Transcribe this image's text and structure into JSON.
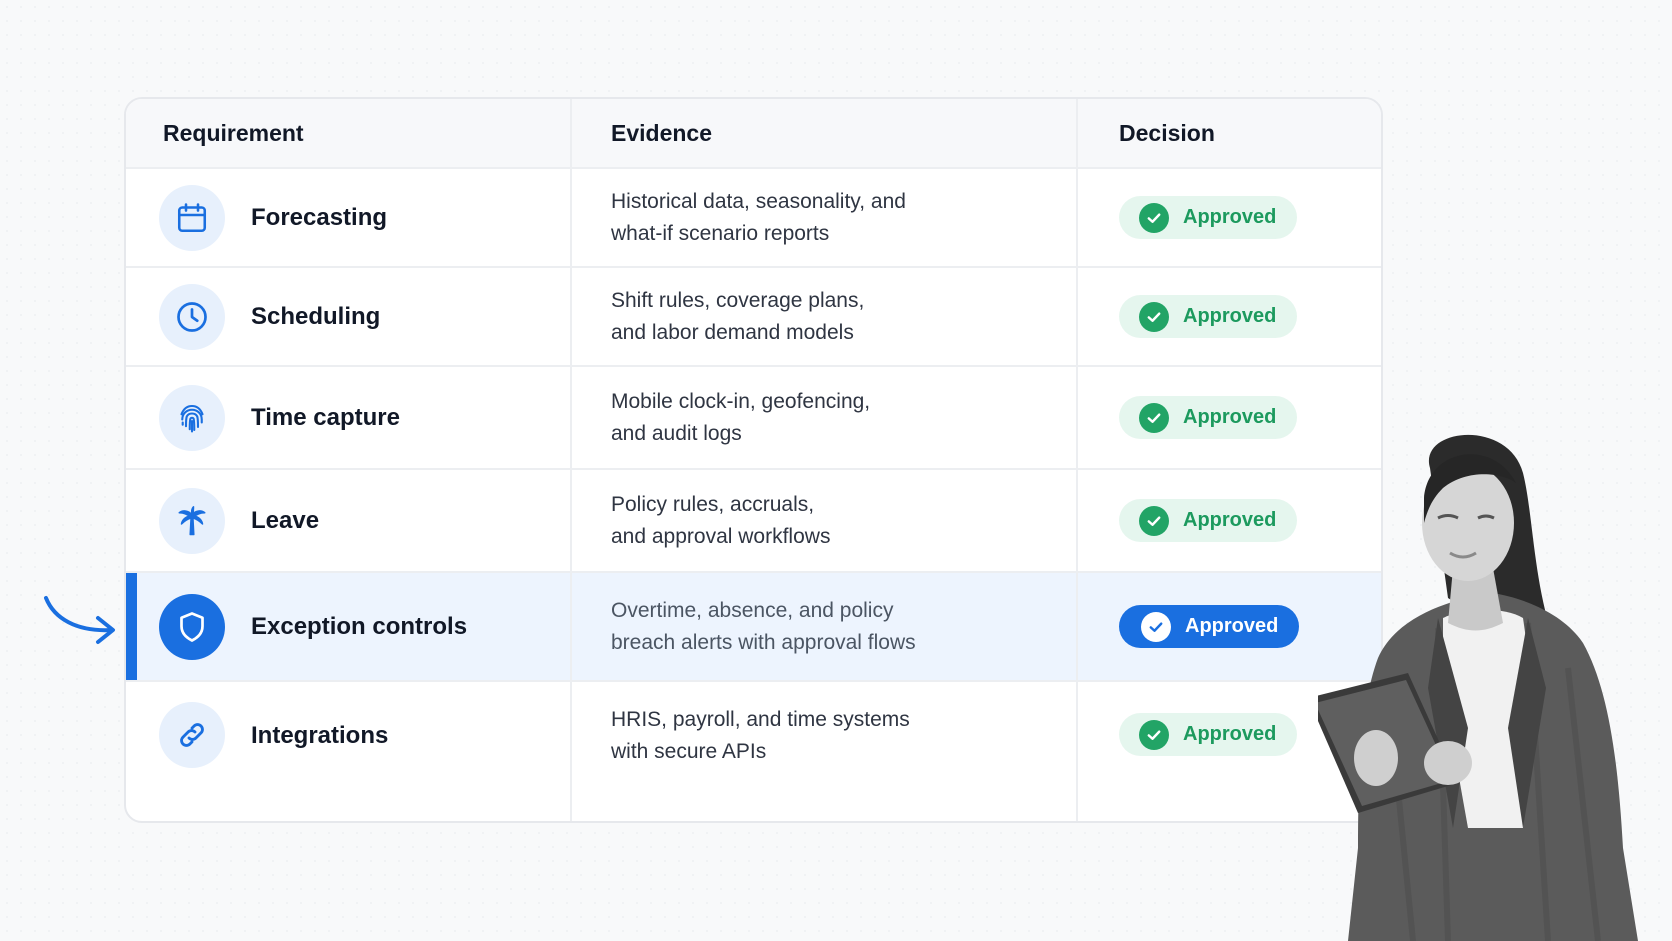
{
  "columns": {
    "requirement": "Requirement",
    "evidence": "Evidence",
    "decision": "Decision"
  },
  "rows": [
    {
      "icon": "calendar-icon",
      "requirement": "Forecasting",
      "evidence_line1": "Historical data, seasonality, and",
      "evidence_line2": "what-if scenario reports",
      "decision": "Approved",
      "selected": false
    },
    {
      "icon": "clock-icon",
      "requirement": "Scheduling",
      "evidence_line1": "Shift rules, coverage plans,",
      "evidence_line2": "and labor demand models",
      "decision": "Approved",
      "selected": false
    },
    {
      "icon": "fingerprint-icon",
      "requirement": "Time capture",
      "evidence_line1": "Mobile clock-in, geofencing,",
      "evidence_line2": "and audit logs",
      "decision": "Approved",
      "selected": false
    },
    {
      "icon": "palm-tree-icon",
      "requirement": "Leave",
      "evidence_line1": "Policy rules, accruals,",
      "evidence_line2": "and approval workflows",
      "decision": "Approved",
      "selected": false
    },
    {
      "icon": "shield-icon",
      "requirement": "Exception controls",
      "evidence_line1": "Overtime, absence, and policy",
      "evidence_line2": "breach alerts with approval flows",
      "decision": "Approved",
      "selected": true
    },
    {
      "icon": "link-icon",
      "requirement": "Integrations",
      "evidence_line1": "HRIS, payroll, and time systems",
      "evidence_line2": "with secure APIs",
      "decision": "Approved",
      "selected": false
    }
  ],
  "colors": {
    "accent": "#1a6fe0",
    "approved_green": "#22a466",
    "approved_bg": "#e5f6ee",
    "selected_row_bg": "#edf4fe",
    "icon_bg": "#e7f0fc"
  },
  "decorations": {
    "pointer": "arrow-icon",
    "photo": "person-holding-tablet-image"
  }
}
